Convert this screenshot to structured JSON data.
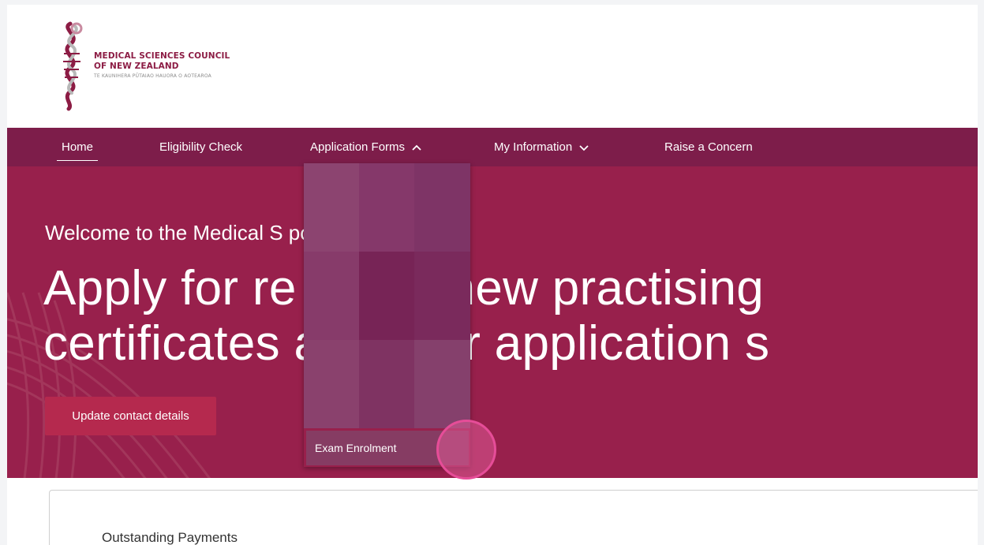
{
  "logo": {
    "line1": "MEDICAL SCIENCES COUNCIL",
    "line2": "OF NEW ZEALAND",
    "line3": "TE KAUNIHERA PŪTAIAO HAUORA O AOTEAROA"
  },
  "nav": {
    "items": [
      {
        "label": "Home",
        "active": true
      },
      {
        "label": "Eligibility Check"
      },
      {
        "label": "Application Forms",
        "icon": "chevron-up-icon"
      },
      {
        "label": "My Information",
        "icon": "chevron-down-icon"
      },
      {
        "label": "Raise a Concern"
      }
    ]
  },
  "hero": {
    "welcome": "Welcome to the Medical S                              portal",
    "headline_line1": "Apply for re                 ion, renew practising",
    "headline_line2": "certificates               ack your application s",
    "update_button": "Update contact details"
  },
  "dropdown": {
    "items": [
      {
        "label": "Exam Enrolment"
      }
    ]
  },
  "card": {
    "title": "Outstanding Payments"
  },
  "colors": {
    "nav_bg": "#7d1d4a",
    "hero_bg": "#98204c",
    "button_bg": "#b5294e",
    "brand": "#8c1c44"
  }
}
